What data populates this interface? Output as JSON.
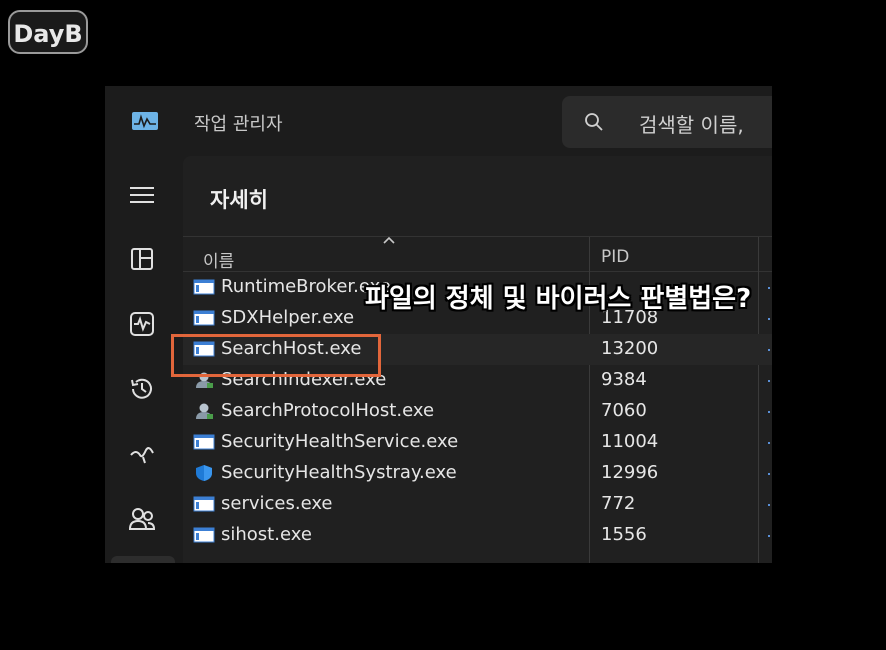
{
  "watermark": {
    "text": "DayB"
  },
  "window": {
    "title": "작업 관리자",
    "search_placeholder": "검색할 이름,"
  },
  "sidebar": {
    "items": [
      {
        "name": "menu",
        "icon": "hamburger-icon"
      },
      {
        "name": "processes",
        "icon": "processes-icon"
      },
      {
        "name": "performance",
        "icon": "performance-icon"
      },
      {
        "name": "app-history",
        "icon": "history-icon"
      },
      {
        "name": "startup-apps",
        "icon": "startup-icon"
      },
      {
        "name": "users",
        "icon": "users-icon"
      },
      {
        "name": "details",
        "icon": "details-icon"
      }
    ]
  },
  "page": {
    "title": "자세히",
    "columns": {
      "name": "이름",
      "pid": "PID"
    }
  },
  "rows": [
    {
      "name": "RuntimeBroker.exe",
      "pid": "",
      "icon": "exe-window-icon"
    },
    {
      "name": "SDXHelper.exe",
      "pid": "11708",
      "icon": "exe-window-icon"
    },
    {
      "name": "SearchHost.exe",
      "pid": "13200",
      "icon": "exe-window-icon",
      "selected": true
    },
    {
      "name": "SearchIndexer.exe",
      "pid": "9384",
      "icon": "user-service-icon"
    },
    {
      "name": "SearchProtocolHost.exe",
      "pid": "7060",
      "icon": "user-service-icon"
    },
    {
      "name": "SecurityHealthService.exe",
      "pid": "11004",
      "icon": "exe-window-icon"
    },
    {
      "name": "SecurityHealthSystray.exe",
      "pid": "12996",
      "icon": "shield-icon"
    },
    {
      "name": "services.exe",
      "pid": "772",
      "icon": "exe-window-icon"
    },
    {
      "name": "sihost.exe",
      "pid": "1556",
      "icon": "exe-window-icon"
    }
  ],
  "overlay": {
    "caption": "파일의 정체 및 바이러스 판별법은?",
    "highlight_color": "#e2663b"
  },
  "colors": {
    "background": "#000000",
    "window": "#1c1c1c",
    "content": "#202020",
    "accent": "#5a8fd6"
  }
}
